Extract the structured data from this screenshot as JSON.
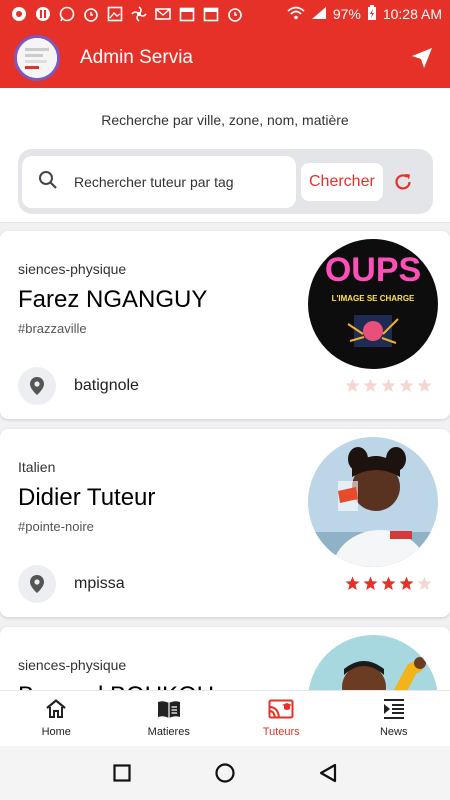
{
  "status_bar": {
    "battery": "97%",
    "time": "10:28 AM",
    "notification_icons": [
      "record-icon",
      "pause-icon",
      "whatsapp-icon",
      "alarm-icon",
      "image-icon",
      "fan-icon",
      "mail-icon",
      "calendar-icon",
      "calendar-icon",
      "alarm-icon"
    ]
  },
  "app_bar": {
    "title": "Admin Servia"
  },
  "search": {
    "hint": "Recherche par ville, zone, nom, matière",
    "placeholder": "Rechercher tuteur par tag",
    "button_label": "Chercher"
  },
  "tutors": [
    {
      "subject": "siences-physique",
      "name": "Farez NGANGUY",
      "tag": "#brazzaville",
      "location": "batignole",
      "rating": 0,
      "photo_text_main": "OUPS",
      "photo_text_sub": "L'IMAGE SE CHARGE"
    },
    {
      "subject": "Italien",
      "name": "Didier Tuteur",
      "tag": "#pointe-noire",
      "location": "mpissa",
      "rating": 4
    },
    {
      "subject": "siences-physique",
      "name": "Bernard BOUKOU",
      "tag": "",
      "location": "",
      "rating": 0
    }
  ],
  "bottom_nav": {
    "items": [
      {
        "label": "Home",
        "icon": "home-icon"
      },
      {
        "label": "Matieres",
        "icon": "book-icon"
      },
      {
        "label": "Tuteurs",
        "icon": "cast-icon"
      },
      {
        "label": "News",
        "icon": "news-icon"
      }
    ],
    "active_index": 2
  },
  "colors": {
    "primary": "#e53127",
    "avatar_ring": "#7e57c2",
    "star_filled": "#e53127",
    "star_empty": "#f4d6d3"
  }
}
